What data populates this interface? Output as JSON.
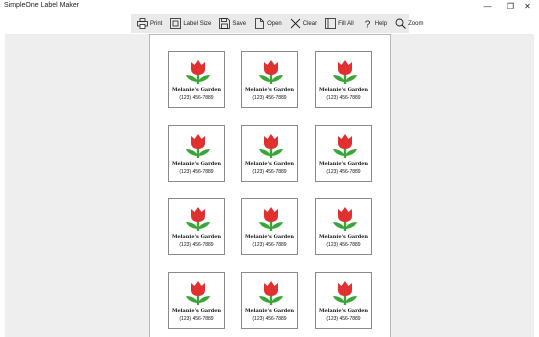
{
  "window": {
    "title": "SimpleOne Label Maker",
    "controls": [
      {
        "name": "minimize",
        "glyph": "—"
      },
      {
        "name": "maximize",
        "glyph": "❐"
      },
      {
        "name": "close",
        "glyph": "✕"
      }
    ]
  },
  "toolbar": {
    "buttons": [
      {
        "label": "Print",
        "icon": "printer-icon"
      },
      {
        "label": "Label Size",
        "icon": "label-size-icon"
      },
      {
        "label": "Save",
        "icon": "save-icon"
      },
      {
        "label": "Open",
        "icon": "open-icon"
      },
      {
        "label": "Clear",
        "icon": "clear-icon"
      },
      {
        "label": "Fill All",
        "icon": "fill-all-icon"
      },
      {
        "label": "Help",
        "icon": "help-icon"
      },
      {
        "label": "Zoom",
        "icon": "zoom-icon"
      }
    ]
  },
  "labels": [
    {
      "name": "Melanie's Garden",
      "phone": "(123) 456-7889"
    },
    {
      "name": "Melanie's Garden",
      "phone": "(123) 456-7889"
    },
    {
      "name": "Melanie's Garden",
      "phone": "(123) 456-7889"
    },
    {
      "name": "Melanie's Garden",
      "phone": "(123) 456-7889"
    },
    {
      "name": "Melanie's Garden",
      "phone": "(123) 456-7889"
    },
    {
      "name": "Melanie's Garden",
      "phone": "(123) 456-7889"
    },
    {
      "name": "Melanie's Garden",
      "phone": "(123) 456-7889"
    },
    {
      "name": "Melanie's Garden",
      "phone": "(123) 456-7889"
    },
    {
      "name": "Melanie's Garden",
      "phone": "(123) 456-7889"
    },
    {
      "name": "Melanie's Garden",
      "phone": "(123) 456-7889"
    },
    {
      "name": "Melanie's Garden",
      "phone": "(123) 456-7889"
    },
    {
      "name": "Melanie's Garden",
      "phone": "(123) 456-7889"
    }
  ],
  "colors": {
    "toolbar_bg": "#eaeaea",
    "workspace_bg": "#eeeeee",
    "tulip_red": "#e03030",
    "leaf_green": "#3aa63a"
  }
}
